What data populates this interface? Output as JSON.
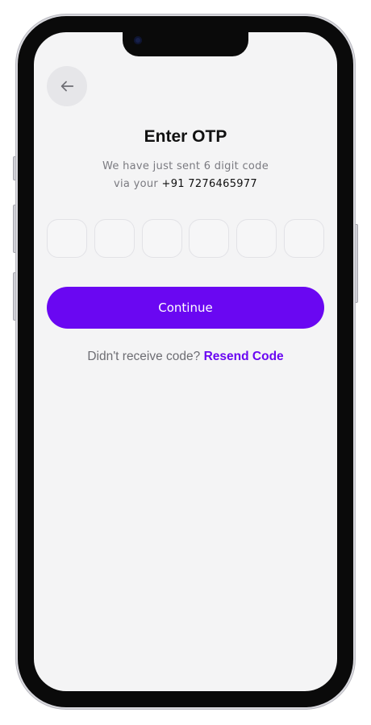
{
  "header": {
    "back_icon": "arrow-left-icon"
  },
  "otp": {
    "title": "Enter OTP",
    "subtitle_line1": "We have just sent 6 digit code",
    "subtitle_line2_prefix": "via your",
    "phone_number": "+91 7276465977",
    "digits": [
      "",
      "",
      "",
      "",
      "",
      ""
    ]
  },
  "actions": {
    "continue_label": "Continue",
    "resend_prompt": "Didn't receive code?",
    "resend_label": "Resend Code"
  },
  "colors": {
    "accent": "#6a07f2",
    "background": "#f4f4f5",
    "muted_text": "#7a7a80"
  }
}
